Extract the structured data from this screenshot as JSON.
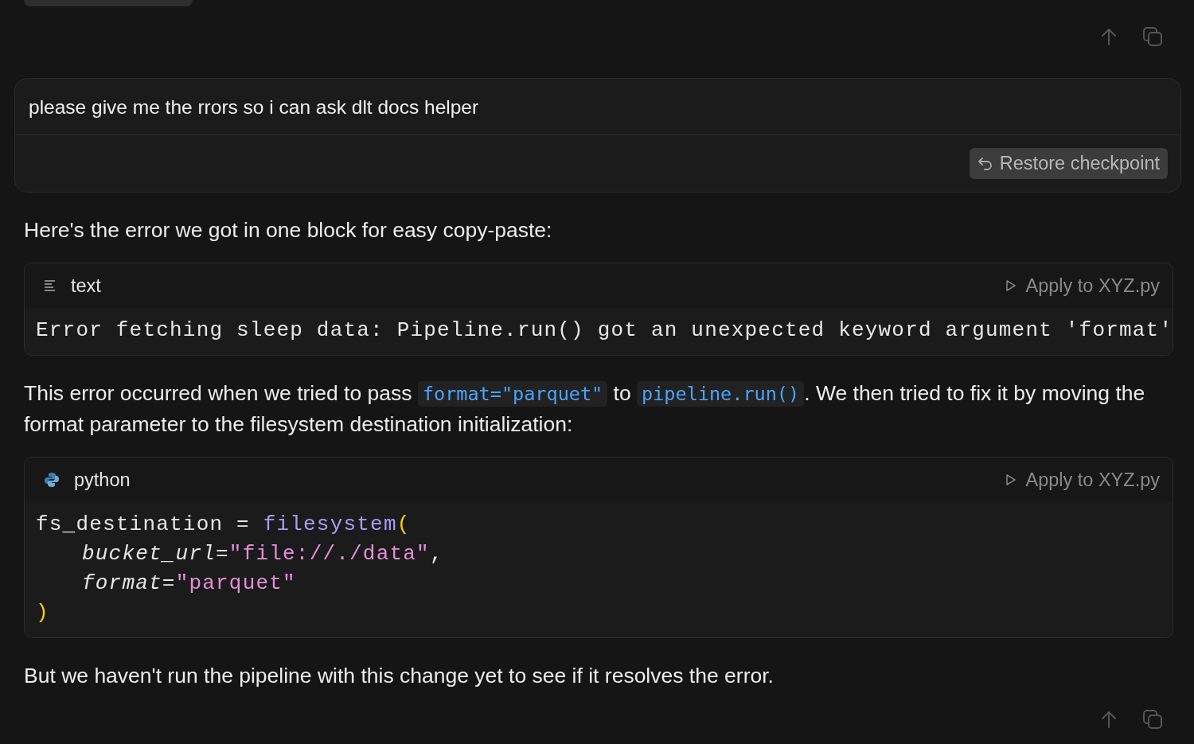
{
  "top_actions": [
    {
      "kind": "up"
    },
    {
      "kind": "copy"
    }
  ],
  "user_message": {
    "text": "please give me the rrors so i can ask dlt docs helper",
    "restore_button": "Restore checkpoint"
  },
  "response": [
    {
      "kind": "paragraph",
      "segments": [
        {
          "kind": "text",
          "text": "Here's the error we got in one block for easy copy-paste:"
        }
      ]
    },
    {
      "kind": "code",
      "language": "text",
      "apply": "Apply to XYZ.py",
      "lines": [
        {
          "indent": false,
          "tokens": [
            {
              "kind": "plain",
              "text": "Error fetching sleep data: Pipeline.run() got an unexpected keyword argument 'format'"
            }
          ]
        }
      ]
    },
    {
      "kind": "paragraph",
      "segments": [
        {
          "kind": "text",
          "text": "This error occurred when we tried to pass "
        },
        {
          "kind": "code",
          "text": "format=\"parquet\""
        },
        {
          "kind": "text",
          "text": " to "
        },
        {
          "kind": "code",
          "text": "pipeline.run()"
        },
        {
          "kind": "text",
          "text": ". We then tried to fix it by moving the format parameter to the filesystem destination initialization:"
        }
      ]
    },
    {
      "kind": "code",
      "language": "python",
      "apply": "Apply to XYZ.py",
      "lines": [
        {
          "indent": false,
          "tokens": [
            {
              "kind": "plain",
              "text": "fs_destination = "
            },
            {
              "kind": "func",
              "text": "filesystem"
            },
            {
              "kind": "paren",
              "text": "("
            }
          ]
        },
        {
          "indent": true,
          "tokens": [
            {
              "kind": "param",
              "text": "bucket_url"
            },
            {
              "kind": "plain",
              "text": "="
            },
            {
              "kind": "string",
              "text": "\"file://./data\""
            },
            {
              "kind": "plain",
              "text": ","
            }
          ]
        },
        {
          "indent": true,
          "tokens": [
            {
              "kind": "param",
              "text": "format"
            },
            {
              "kind": "plain",
              "text": "="
            },
            {
              "kind": "string",
              "text": "\"parquet\""
            }
          ]
        },
        {
          "indent": false,
          "tokens": [
            {
              "kind": "paren",
              "text": ")"
            }
          ]
        }
      ]
    },
    {
      "kind": "paragraph",
      "segments": [
        {
          "kind": "text",
          "text": "But we haven't run the pipeline with this change yet to see if it resolves the error."
        }
      ]
    }
  ],
  "bottom_actions": [
    {
      "kind": "up"
    },
    {
      "kind": "copy"
    }
  ]
}
